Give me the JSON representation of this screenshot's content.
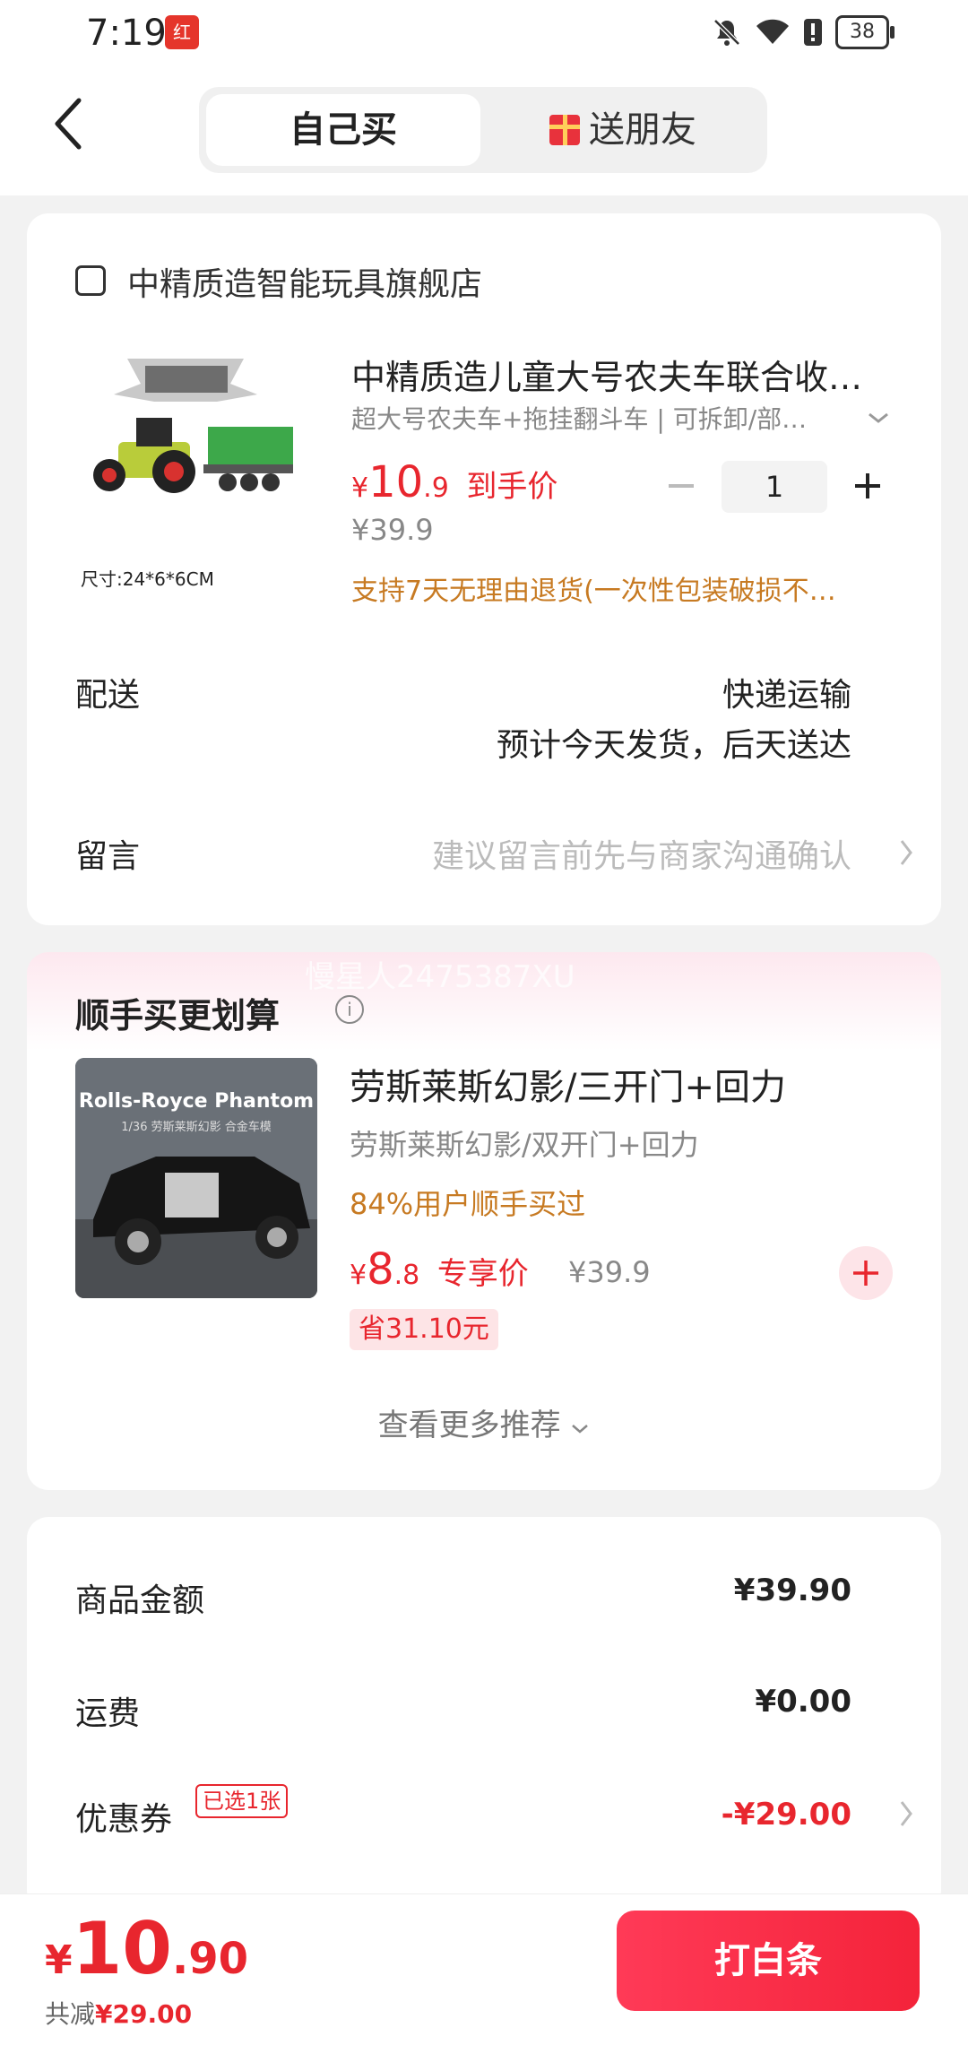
{
  "status_bar": {
    "time": "7:19",
    "battery": "38"
  },
  "header": {
    "tab_self": "自己买",
    "tab_gift": "送朋友"
  },
  "store": {
    "name": "中精质造智能玩具旗舰店"
  },
  "product": {
    "image_caption": "尺寸:24*6*6CM",
    "title": "中精质造儿童大号农夫车联合收…",
    "spec": "超大号农夫车+拖挂翻斗车 | 可拆卸/部…",
    "price_symbol": "¥",
    "price_int": "10",
    "price_dec": ".9",
    "price_tag": "到手价",
    "original_price": "¥39.9",
    "quantity": "1",
    "policy": "支持7天无理由退货(一次性包装破损不…"
  },
  "delivery": {
    "label": "配送",
    "method": "快递运输",
    "eta": "预计今天发货，后天送达"
  },
  "message": {
    "label": "留言",
    "placeholder": "建议留言前先与商家沟通确认"
  },
  "recommend": {
    "title": "顺手买更划算",
    "watermark": "慢星人2475387XU",
    "image_title": "Rolls-Royce Phantom",
    "image_subtitle": "1/36 劳斯莱斯幻影 合金车模",
    "item_title": "劳斯莱斯幻影/三开门+回力",
    "item_alt": "劳斯莱斯幻影/双开门+回力",
    "item_stat": "84%用户顺手买过",
    "price_symbol": "¥",
    "price_int": "8",
    "price_dec": ".8",
    "price_tag": "专享价",
    "original_price": "¥39.9",
    "save": "省31.10元",
    "more": "查看更多推荐"
  },
  "summary": {
    "goods_label": "商品金额",
    "goods_value": "¥39.90",
    "shipping_label": "运费",
    "shipping_value": "¥0.00",
    "coupon_label": "优惠券",
    "coupon_badge": "已选1张",
    "coupon_value": "-¥29.00"
  },
  "footer": {
    "currency": "¥",
    "total_int": "10",
    "total_dec": ".90",
    "saved_prefix": "共减",
    "saved_value": "¥29.00",
    "pay_label": "打白条"
  },
  "colors": {
    "accent": "#e8262e",
    "orange": "#c77a22",
    "pay_gradient_start": "#ff3a57"
  }
}
